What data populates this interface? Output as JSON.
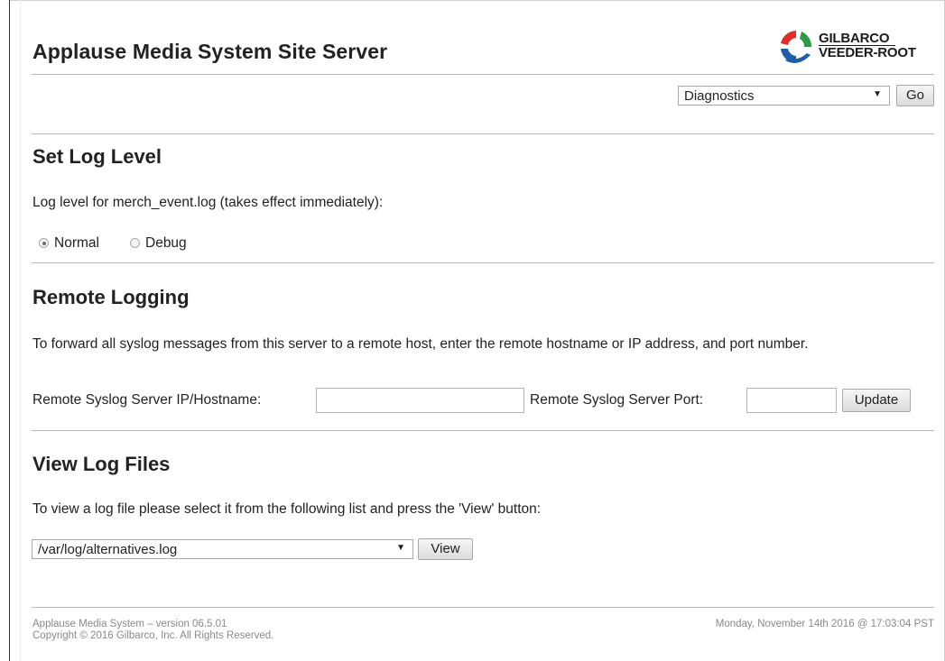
{
  "header": {
    "title": "Applause Media System Site Server",
    "logo": {
      "line1": "GILBARCO",
      "line2": "VEEDER-ROOT"
    }
  },
  "nav": {
    "selected": "Diagnostics",
    "go_label": "Go"
  },
  "log_level": {
    "heading": "Set Log Level",
    "description": "Log level for merch_event.log (takes effect immediately):",
    "options": [
      {
        "label": "Normal",
        "checked": true
      },
      {
        "label": "Debug",
        "checked": false
      }
    ]
  },
  "remote_logging": {
    "heading": "Remote Logging",
    "description": "To forward all syslog messages from this server to a remote host, enter the remote hostname or IP address, and port number.",
    "host_label": "Remote Syslog Server IP/Hostname:",
    "host_value": "",
    "port_label": "Remote Syslog Server Port:",
    "port_value": "",
    "update_label": "Update"
  },
  "view_logs": {
    "heading": "View Log Files",
    "description": "To view a log file please select it from the following list and press the 'View' button:",
    "selected_file": "/var/log/alternatives.log",
    "view_label": "View"
  },
  "footer": {
    "version": "Applause Media System – version 06.5.01",
    "copyright": "Copyright © 2016 Gilbarco, Inc. All Rights Reserved.",
    "timestamp": "Monday, November 14th 2016 @ 17:03:04 PST"
  },
  "colors": {
    "logo_red": "#e02d2d",
    "logo_blue": "#1f5ea8",
    "logo_green": "#2e9a45"
  }
}
